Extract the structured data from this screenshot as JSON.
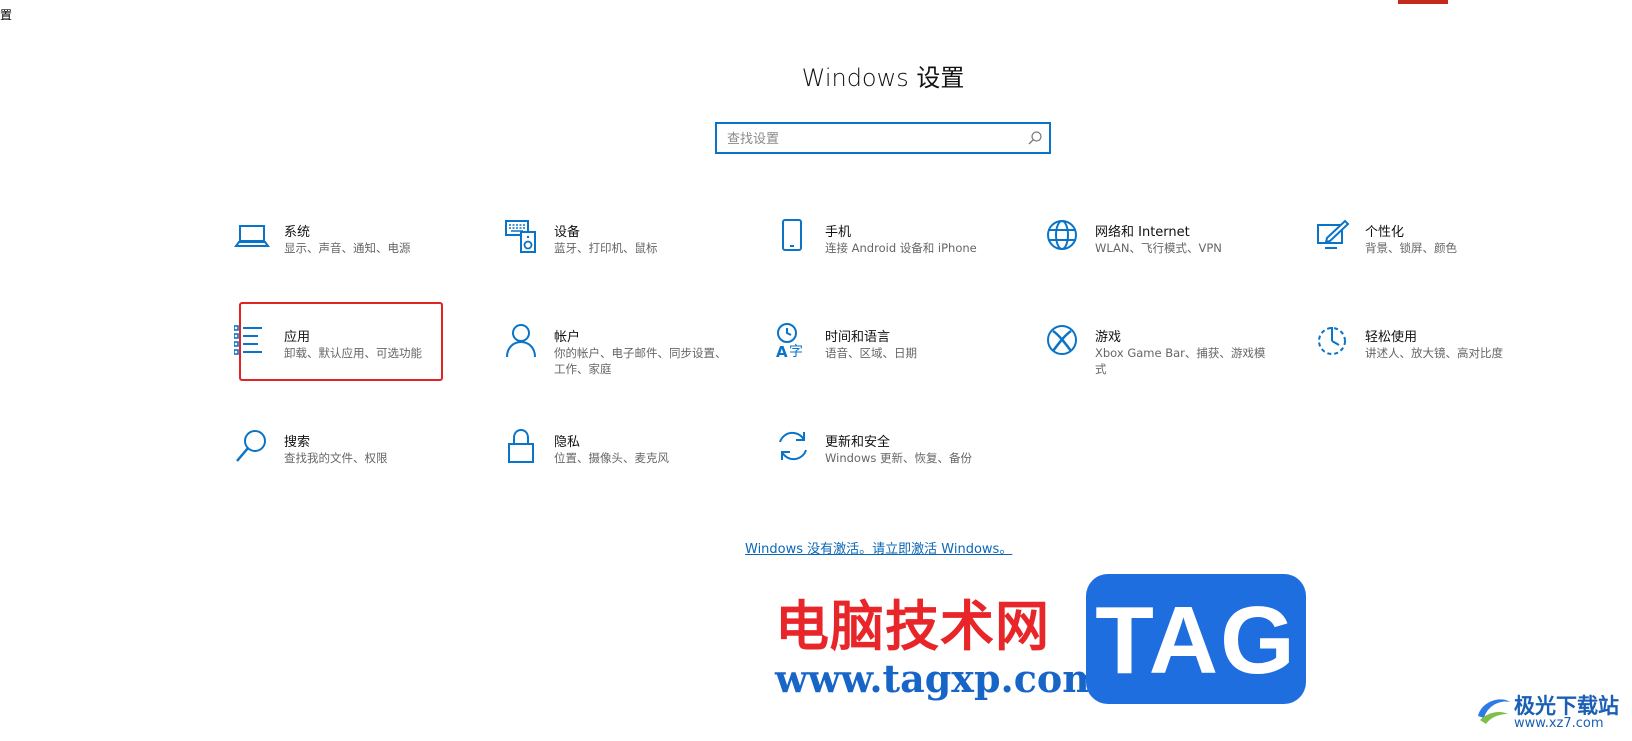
{
  "window": {
    "title_fragment": "置"
  },
  "header": {
    "title": "Windows 设置"
  },
  "search": {
    "placeholder": "查找设置"
  },
  "tiles": [
    {
      "icon": "laptop-icon",
      "name": "系统",
      "desc": "显示、声音、通知、电源"
    },
    {
      "icon": "keyboard-speaker-icon",
      "name": "设备",
      "desc": "蓝牙、打印机、鼠标"
    },
    {
      "icon": "phone-icon",
      "name": "手机",
      "desc": "连接 Android 设备和 iPhone"
    },
    {
      "icon": "globe-icon",
      "name": "网络和 Internet",
      "desc": "WLAN、飞行模式、VPN"
    },
    {
      "icon": "personalization-icon",
      "name": "个性化",
      "desc": "背景、锁屏、颜色"
    },
    {
      "icon": "apps-list-icon",
      "name": "应用",
      "desc": "卸载、默认应用、可选功能"
    },
    {
      "icon": "person-icon",
      "name": "帐户",
      "desc": "你的帐户、电子邮件、同步设置、工作、家庭"
    },
    {
      "icon": "time-language-icon",
      "name": "时间和语言",
      "desc": "语音、区域、日期"
    },
    {
      "icon": "xbox-icon",
      "name": "游戏",
      "desc": "Xbox Game Bar、捕获、游戏模式"
    },
    {
      "icon": "ease-of-access-icon",
      "name": "轻松使用",
      "desc": "讲述人、放大镜、高对比度"
    },
    {
      "icon": "search-icon",
      "name": "搜索",
      "desc": "查找我的文件、权限"
    },
    {
      "icon": "lock-icon",
      "name": "隐私",
      "desc": "位置、摄像头、麦克风"
    },
    {
      "icon": "update-sync-icon",
      "name": "更新和安全",
      "desc": "Windows 更新、恢复、备份"
    }
  ],
  "activation": {
    "link": "Windows 没有激活。请立即激活 Windows。"
  },
  "watermark": {
    "site_name": "电脑技术网",
    "tag": "TAG",
    "url": "www.tagxp.com",
    "secondary_name": "极光下载站",
    "secondary_url": "www.xz7.com"
  },
  "colors": {
    "accent": "#0a74c8",
    "highlight": "#e02424",
    "link": "#0a67b8"
  }
}
